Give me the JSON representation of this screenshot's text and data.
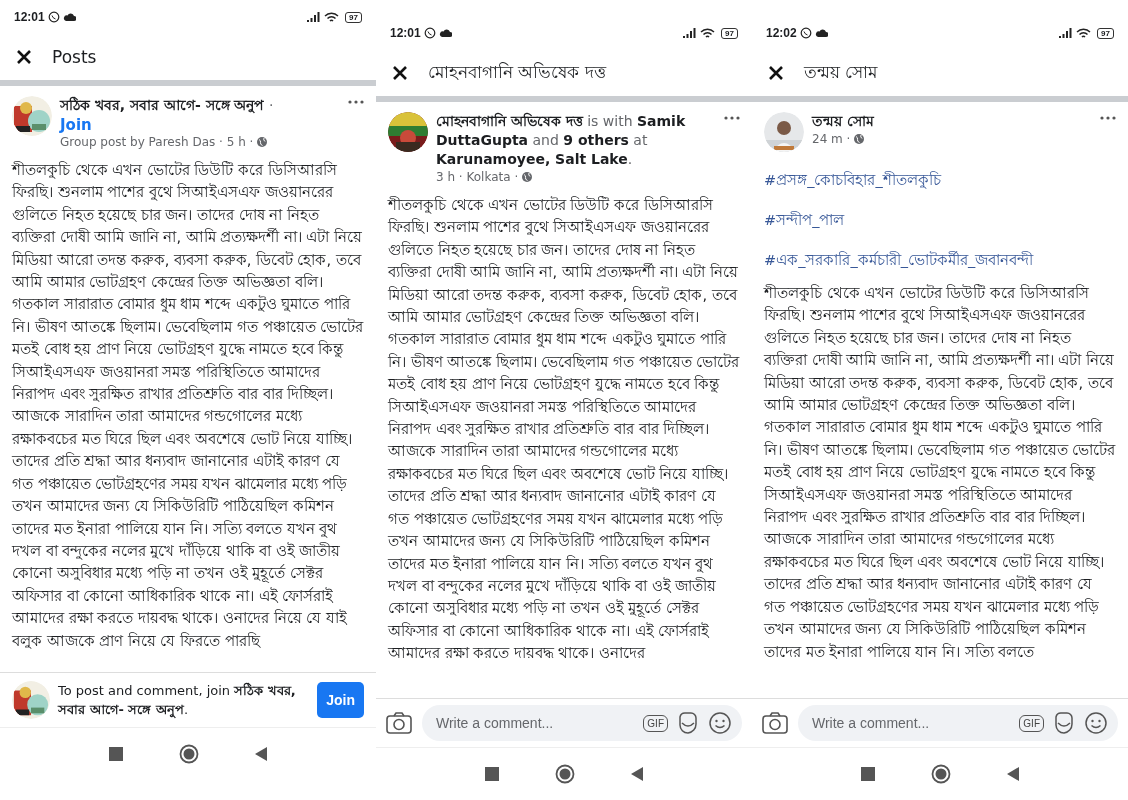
{
  "panels": [
    {
      "status_bar": {
        "time": "12:01",
        "battery": "97"
      },
      "header": {
        "title": "Posts"
      },
      "post": {
        "author": "সঠিক খবর, সবার আগে- সঙ্গে অনুপ",
        "headline_rest": "·",
        "join_link": "Join",
        "meta": "Group post by Paresh Das · 5 h ·",
        "paragraphs": [
          "শীতলকুচি থেকে এখন ভোটের ডিউটি করে ডিসিআরসি ফিরছি। শুনলাম পাশের বুথে সিআইএসএফ জওয়ানরের গুলিতে নিহত হয়েছে চার জন। তাদের দোষ না নিহত ব্যক্তিরা দোষী আমি জানি না, আমি প্রত্যক্ষদর্শী না। এটা নিয়ে মিডিয়া আরো তদন্ত করুক, ব্যবসা করুক, ডিবেট হোক, তবে আমি আমার ভোটগ্রহণ কেন্দ্রের তিক্ত অভিজ্ঞতা বলি।",
          "গতকাল সারারাত বোমার ধুম ধাম শব্দে একটুও ঘুমাতে পারি নি। ভীষণ আতঙ্কে ছিলাম। ভেবেছিলাম গত পঞ্চায়েত ভোটের মতই বোধ হয় প্রাণ নিয়ে ভোটগ্রহণ যুদ্ধে নামতে হবে কিন্তু সিআইএসএফ জওয়ানরা সমস্ত পরিস্থিতিতে আমাদের নিরাপদ এবং সুরক্ষিত রাখার প্রতিশ্রুতি বার বার দিচ্ছিল। আজকে সারাদিন তারা আমাদের গন্ডগোলের মধ্যে রক্ষাকবচের মত ঘিরে ছিল এবং অবশেষে ভোট নিয়ে যাচ্ছি। তাদের প্রতি শ্রদ্ধা আর ধন্যবাদ জানানোর এটাই কারণ যে গত পঞ্চায়েত ভোটগ্রহণের সময় যখন ঝামেলার মধ্যে পড়ি তখন আমাদের জন্য যে সিকিউরিটি পাঠিয়েছিল কমিশন তাদের মত ইনারা পালিয়ে যান নি। সত্যি বলতে যখন বুথ দখল বা বন্দুকের নলের মুখে দাঁড়িয়ে থাকি বা ওই জাতীয় কোনো অসুবিধার মধ্যে পড়ি না তখন ওই মুহূর্তে সেক্টর অফিসার বা কোনো আধিকারিক থাকে না। এই ফোর্সরাই আমাদের রক্ষা করতে দায়বদ্ধ থাকে। ওনাদের নিয়ে যে যাই বলুক আজকে প্রাণ নিয়ে যে ফিরতে পারছি"
        ]
      },
      "footer": {
        "kind": "join_prompt",
        "text": "To post and comment, join **সঠিক খবর, সবার আগে- সঙ্গে অনুপ**.",
        "button": "Join"
      }
    },
    {
      "status_bar": {
        "time": "12:01",
        "battery": "97"
      },
      "header": {
        "title": "মোহনবাগানি অভিষেক দত্ত"
      },
      "post": {
        "author": "মোহনবাগানি অভিষেক দত্ত",
        "headline_rest": "is with **Samik DuttaGupta** and **9 others** at **Karunamoyee, Salt Lake**.",
        "meta": "3 h · Kolkata ·",
        "paragraphs": [
          "শীতলকুচি থেকে এখন ভোটের ডিউটি করে ডিসিআরসি ফিরছি। শুনলাম পাশের বুথে সিআইএসএফ জওয়ানরের গুলিতে নিহত হয়েছে চার জন। তাদের দোষ না নিহত ব্যক্তিরা দোষী আমি জানি না, আমি প্রত্যক্ষদর্শী না। এটা নিয়ে মিডিয়া আরো তদন্ত করুক, ব্যবসা করুক, ডিবেট হোক, তবে আমি আমার ভোটগ্রহণ কেন্দ্রের তিক্ত অভিজ্ঞতা বলি।",
          "গতকাল সারারাত বোমার ধুম ধাম শব্দে একটুও ঘুমাতে পারি নি। ভীষণ আতঙ্কে ছিলাম। ভেবেছিলাম গত পঞ্চায়েত ভোটের মতই বোধ হয় প্রাণ নিয়ে ভোটগ্রহণ যুদ্ধে নামতে হবে কিন্তু সিআইএসএফ জওয়ানরা সমস্ত পরিস্থিতিতে আমাদের নিরাপদ এবং সুরক্ষিত রাখার প্রতিশ্রুতি বার বার দিচ্ছিল। আজকে সারাদিন তারা আমাদের গন্ডগোলের মধ্যে রক্ষাকবচের মত ঘিরে ছিল এবং অবশেষে ভোট নিয়ে যাচ্ছি। তাদের প্রতি শ্রদ্ধা আর ধন্যবাদ জানানোর এটাই কারণ যে গত পঞ্চায়েত ভোটগ্রহণের সময় যখন ঝামেলার মধ্যে পড়ি তখন আমাদের জন্য যে সিকিউরিটি পাঠিয়েছিল কমিশন তাদের মত ইনারা পালিয়ে যান নি। সত্যি বলতে যখন বুথ দখল বা বন্দুকের নলের মুখে দাঁড়িয়ে থাকি বা ওই জাতীয় কোনো অসুবিধার মধ্যে পড়ি না তখন ওই মুহূর্তে সেক্টর অফিসার বা কোনো আধিকারিক থাকে না। এই ফোর্সরাই আমাদের রক্ষা করতে দায়বদ্ধ থাকে। ওনাদের"
        ]
      },
      "footer": {
        "kind": "comment_bar",
        "placeholder": "Write a comment...",
        "gif_label": "GIF"
      }
    },
    {
      "status_bar": {
        "time": "12:02",
        "battery": "97"
      },
      "header": {
        "title": "তন্ময় সোম"
      },
      "post": {
        "author": "তন্ময় সোম",
        "meta": "24 m ·",
        "hashtags": [
          "#প্রসঙ্গ_কোচবিহার_শীতলকুচি",
          "#সন্দীপ_পাল",
          "#এক_সরকারি_কর্মচারী_ভোটকর্মীর_জবানবন্দী"
        ],
        "paragraphs": [
          "শীতলকুচি থেকে এখন ভোটের ডিউটি করে ডিসিআরসি ফিরছি। শুনলাম পাশের বুথে সিআইএসএফ জওয়ানরের গুলিতে নিহত হয়েছে চার জন। তাদের দোষ না নিহত ব্যক্তিরা দোষী আমি জানি না, আমি প্রত্যক্ষদর্শী না। এটা নিয়ে মিডিয়া আরো তদন্ত করুক, ব্যবসা করুক, ডিবেট হোক, তবে আমি আমার ভোটগ্রহণ কেন্দ্রের তিক্ত অভিজ্ঞতা বলি।",
          "গতকাল সারারাত বোমার ধুম ধাম শব্দে একটুও ঘুমাতে পারি নি। ভীষণ আতঙ্কে ছিলাম। ভেবেছিলাম গত পঞ্চায়েত ভোটের মতই বোধ হয় প্রাণ নিয়ে ভোটগ্রহণ যুদ্ধে নামতে হবে কিন্তু সিআইএসএফ জওয়ানরা সমস্ত পরিস্থিতিতে আমাদের নিরাপদ এবং সুরক্ষিত রাখার প্রতিশ্রুতি বার বার দিচ্ছিল। আজকে সারাদিন তারা আমাদের গন্ডগোলের মধ্যে রক্ষাকবচের মত ঘিরে ছিল এবং অবশেষে ভোট নিয়ে যাচ্ছি। তাদের প্রতি শ্রদ্ধা আর ধন্যবাদ জানানোর এটাই কারণ যে গত পঞ্চায়েত ভোটগ্রহণের সময় যখন ঝামেলার মধ্যে পড়ি তখন আমাদের জন্য যে সিকিউরিটি পাঠিয়েছিল কমিশন তাদের মত ইনারা পালিয়ে যান নি। সত্যি বলতে"
        ]
      },
      "footer": {
        "kind": "comment_bar",
        "placeholder": "Write a comment...",
        "gif_label": "GIF"
      }
    }
  ]
}
